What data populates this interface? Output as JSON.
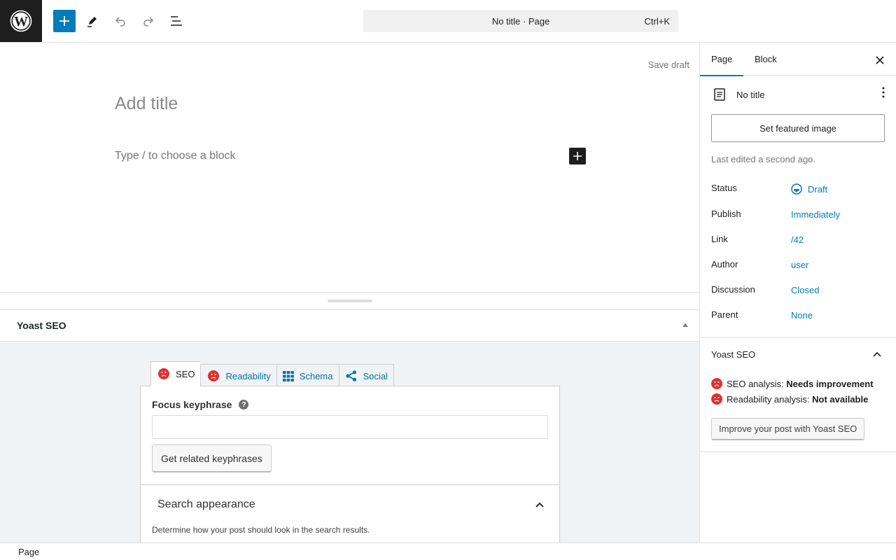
{
  "topbar": {
    "command_title": "No title · Page",
    "command_shortcut": "Ctrl+K"
  },
  "editor": {
    "save_draft": "Save draft",
    "title_placeholder": "Add title",
    "block_placeholder": "Type / to choose a block"
  },
  "yoast_meta": {
    "header": "Yoast SEO",
    "tabs": [
      {
        "label": "SEO",
        "icon": "sad-face-icon"
      },
      {
        "label": "Readability",
        "icon": "sad-face-icon"
      },
      {
        "label": "Schema",
        "icon": "grid-icon"
      },
      {
        "label": "Social",
        "icon": "share-icon"
      }
    ],
    "focus_keyphrase_label": "Focus keyphrase",
    "focus_keyphrase_value": "",
    "related_button": "Get related keyphrases",
    "search_appearance_title": "Search appearance",
    "search_appearance_desc": "Determine how your post should look in the search results."
  },
  "footer": {
    "breadcrumb": "Page"
  },
  "sidebar": {
    "tabs": [
      {
        "label": "Page"
      },
      {
        "label": "Block"
      }
    ],
    "doc_title": "No title",
    "featured_button": "Set featured image",
    "last_edited": "Last edited a second ago.",
    "rows": [
      {
        "label": "Status",
        "value": "Draft"
      },
      {
        "label": "Publish",
        "value": "Immediately"
      },
      {
        "label": "Link",
        "value": "/42"
      },
      {
        "label": "Author",
        "value": "user"
      },
      {
        "label": "Discussion",
        "value": "Closed"
      },
      {
        "label": "Parent",
        "value": "None"
      }
    ],
    "yoast": {
      "title": "Yoast SEO",
      "seo_label": "SEO analysis:",
      "seo_value": "Needs improvement",
      "read_label": "Readability analysis:",
      "read_value": "Not available",
      "improve_button": "Improve your post with Yoast SEO"
    }
  },
  "colors": {
    "accent": "#007cba",
    "dark": "#1e1e1e",
    "sad": "#dc3232",
    "yoast_link": "#0073aa"
  }
}
